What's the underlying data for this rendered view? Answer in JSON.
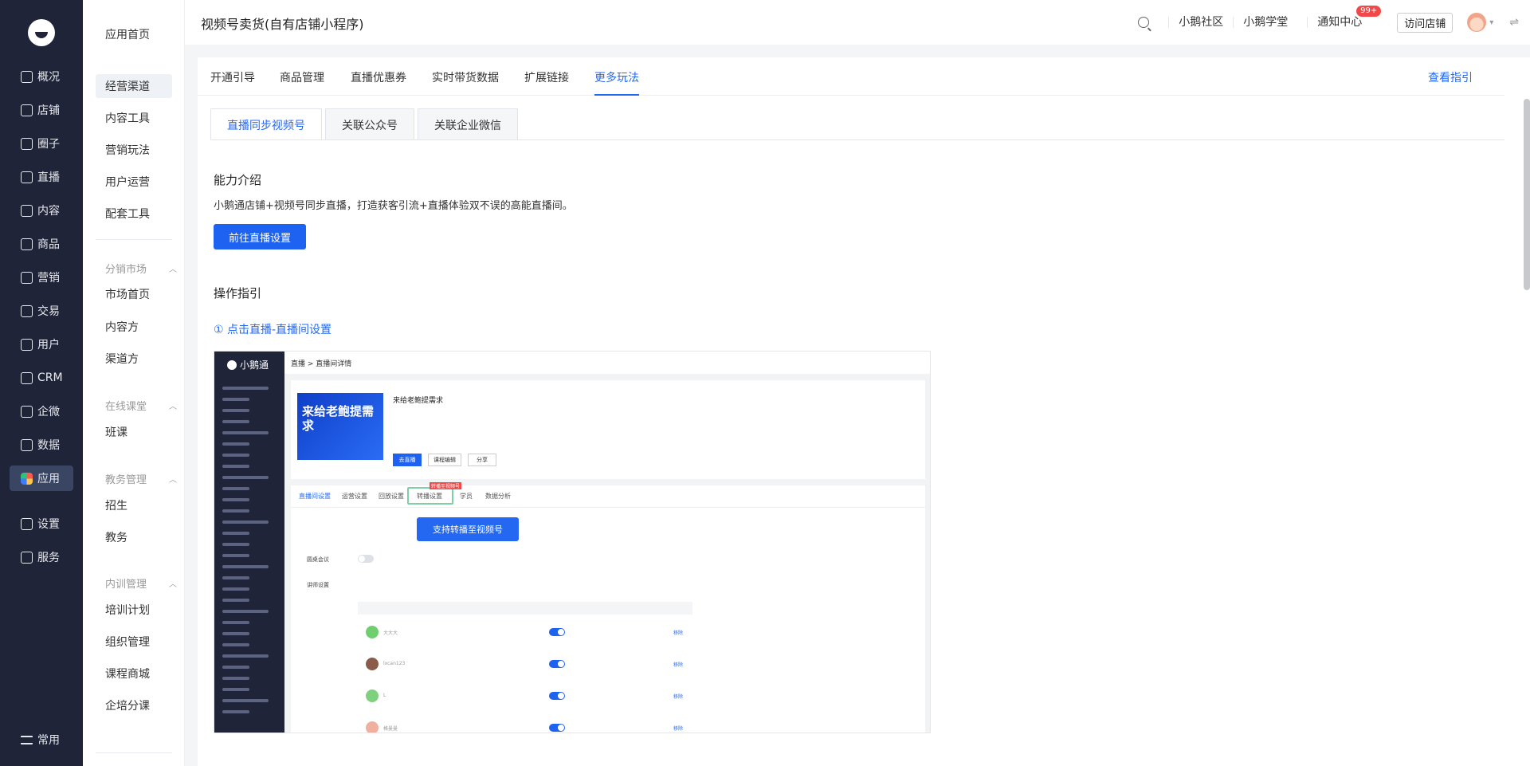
{
  "nav": {
    "items": [
      {
        "label": "概况",
        "icon": "dashboard-icon"
      },
      {
        "label": "店铺",
        "icon": "store-icon"
      },
      {
        "label": "圈子",
        "icon": "circle-icon"
      },
      {
        "label": "直播",
        "icon": "live-icon"
      },
      {
        "label": "内容",
        "icon": "content-icon"
      },
      {
        "label": "商品",
        "icon": "goods-icon"
      },
      {
        "label": "营销",
        "icon": "marketing-icon"
      },
      {
        "label": "交易",
        "icon": "trade-icon"
      },
      {
        "label": "用户",
        "icon": "user-icon"
      },
      {
        "label": "CRM",
        "icon": "crm-icon"
      },
      {
        "label": "企微",
        "icon": "wecom-icon"
      },
      {
        "label": "数据",
        "icon": "data-icon"
      },
      {
        "label": "应用",
        "icon": "apps-icon"
      },
      {
        "label": "设置",
        "icon": "settings-icon"
      },
      {
        "label": "服务",
        "icon": "service-icon"
      }
    ],
    "common": "常用"
  },
  "submenu": {
    "home": "应用首页",
    "top": [
      "经营渠道",
      "内容工具",
      "营销玩法",
      "用户运营",
      "配套工具"
    ],
    "groups": [
      {
        "title": "分销市场",
        "items": [
          "市场首页",
          "内容方",
          "渠道方"
        ]
      },
      {
        "title": "在线课堂",
        "items": [
          "班课"
        ]
      },
      {
        "title": "教务管理",
        "items": [
          "招生",
          "教务"
        ]
      },
      {
        "title": "内训管理",
        "items": [
          "培训计划",
          "组织管理",
          "课程商城",
          "企培分课"
        ]
      }
    ]
  },
  "header": {
    "title": "视频号卖货(自有店铺小程序)",
    "links": [
      "小鹅社区",
      "小鹅学堂"
    ],
    "notice": "通知中心",
    "notice_badge": "99+",
    "visit_store": "访问店铺"
  },
  "tabs": [
    "开通引导",
    "商品管理",
    "直播优惠券",
    "实时带货数据",
    "扩展链接",
    "更多玩法"
  ],
  "guide_link": "查看指引",
  "subtabs": [
    "直播同步视频号",
    "关联公众号",
    "关联企业微信"
  ],
  "intro": {
    "title": "能力介绍",
    "desc": "小鹅通店铺+视频号同步直播，打造获客引流+直播体验双不误的高能直播间。",
    "button": "前往直播设置"
  },
  "guide": {
    "title": "操作指引",
    "step1": "① 点击直播-直播间设置"
  },
  "screenshot": {
    "logo": "小鹅通",
    "crumb": "直播 > 直播间详情",
    "poster": "来给老鲍提需求",
    "name": "来给老鲍提需求",
    "buttons": [
      "去直播",
      "课程编辑",
      "分享"
    ],
    "tabs": [
      "直播间设置",
      "运营设置",
      "回放设置",
      "转播设置",
      "学员",
      "数据分析"
    ],
    "hl_tag": "转播至视频号",
    "callout": "支持转播至视频号",
    "labels": [
      "圆桌会议",
      "讲师设置"
    ],
    "rows": [
      "大大大",
      "lxcan123",
      "L",
      "格曼曼"
    ],
    "remove": "移除"
  }
}
